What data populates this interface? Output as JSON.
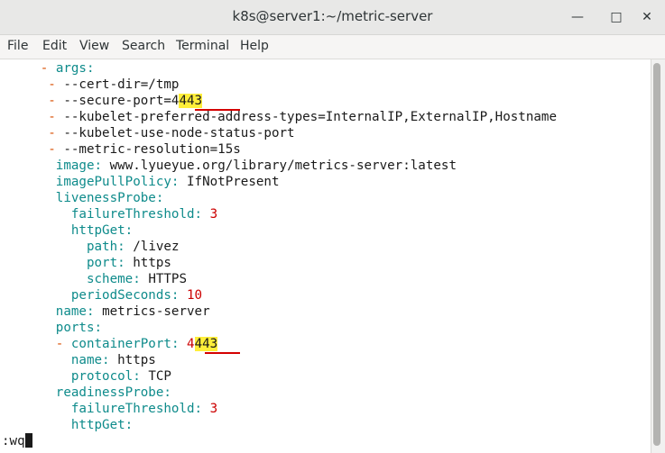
{
  "window": {
    "title": "k8s@server1:~/metric-server"
  },
  "menu": [
    "File",
    "Edit",
    "View",
    "Search",
    "Terminal",
    "Help"
  ],
  "lines": {
    "l0": {
      "indent": "     ",
      "dash": "- ",
      "key": "args",
      "sep": ":",
      "value": ""
    },
    "l1": {
      "indent": "      ",
      "dash": "- ",
      "text": "--cert-dir=/tmp"
    },
    "l2": {
      "indent": "      ",
      "dash": "- ",
      "text": "--secure-port=4",
      "hl": "443"
    },
    "l3": {
      "indent": "      ",
      "dash": "- ",
      "text": "--kubelet-preferred-address-types=InternalIP,ExternalIP,Hostname"
    },
    "l4": {
      "indent": "      ",
      "dash": "- ",
      "text": "--kubelet-use-node-status-port"
    },
    "l5": {
      "indent": "      ",
      "dash": "- ",
      "text": "--metric-resolution=15s"
    },
    "l6": {
      "indent": "       ",
      "key": "image",
      "sep": ": ",
      "value": "www.lyueyue.org/library/metrics-server:latest"
    },
    "l7": {
      "indent": "       ",
      "key": "imagePullPolicy",
      "sep": ": ",
      "value": "IfNotPresent"
    },
    "l8": {
      "indent": "       ",
      "key": "livenessProbe",
      "sep": ":"
    },
    "l9": {
      "indent": "         ",
      "key": "failureThreshold",
      "sep": ": ",
      "num": "3"
    },
    "l10": {
      "indent": "         ",
      "key": "httpGet",
      "sep": ":"
    },
    "l11": {
      "indent": "           ",
      "key": "path",
      "sep": ": ",
      "value": "/livez"
    },
    "l12": {
      "indent": "           ",
      "key": "port",
      "sep": ": ",
      "value": "https"
    },
    "l13": {
      "indent": "           ",
      "key": "scheme",
      "sep": ": ",
      "value": "HTTPS"
    },
    "l14": {
      "indent": "         ",
      "key": "periodSeconds",
      "sep": ": ",
      "num": "10"
    },
    "l15": {
      "indent": "       ",
      "key": "name",
      "sep": ": ",
      "value": "metrics-server"
    },
    "l16": {
      "indent": "       ",
      "key": "ports",
      "sep": ":"
    },
    "l17": {
      "indent": "       ",
      "dash": "- ",
      "key": "containerPort",
      "sep": ": ",
      "num": "4",
      "hl": "443"
    },
    "l18": {
      "indent": "         ",
      "key": "name",
      "sep": ": ",
      "value": "https"
    },
    "l19": {
      "indent": "         ",
      "key": "protocol",
      "sep": ": ",
      "value": "TCP"
    },
    "l20": {
      "indent": "       ",
      "key": "readinessProbe",
      "sep": ":"
    },
    "l21": {
      "indent": "         ",
      "key": "failureThreshold",
      "sep": ": ",
      "num": "3"
    },
    "l22": {
      "indent": "         ",
      "key": "httpGet",
      "sep": ":"
    }
  },
  "command": ":wq",
  "colors": {
    "dash": "#d84e00",
    "key": "#0e8b8b",
    "number": "#cc0000",
    "highlight": "#ffef3a",
    "underline": "#d40000"
  }
}
